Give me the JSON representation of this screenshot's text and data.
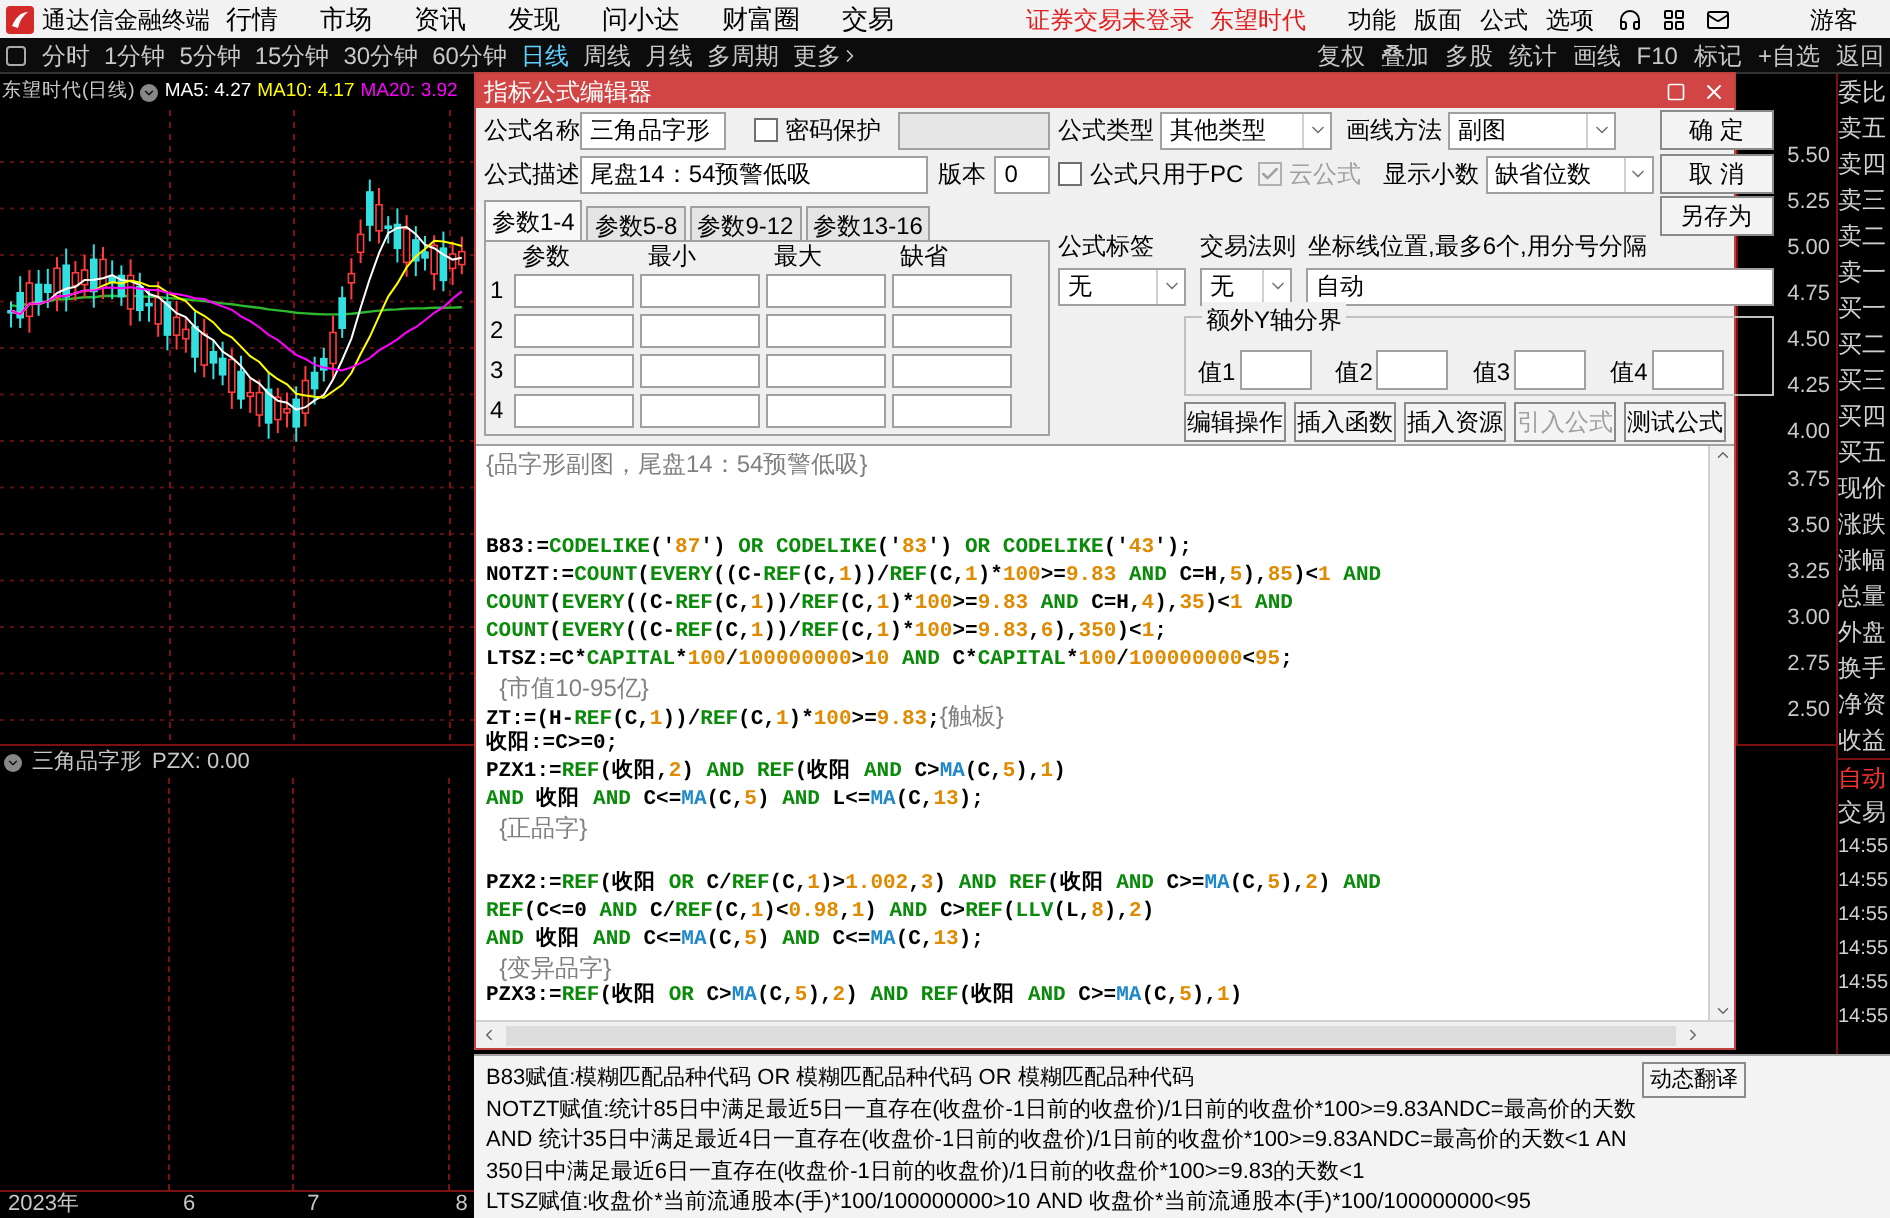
{
  "app_bar": {
    "title": "通达信金融终端",
    "menus": [
      "行情",
      "市场",
      "资讯",
      "发现",
      "问小达",
      "财富圈",
      "交易"
    ],
    "login_status": "证券交易未登录",
    "stock_name": "东望时代",
    "actions": [
      "功能",
      "版面",
      "公式",
      "选项"
    ],
    "user": "游客"
  },
  "toolbar": {
    "periods": [
      {
        "label": "分时",
        "selected": false
      },
      {
        "label": "1分钟",
        "selected": false
      },
      {
        "label": "5分钟",
        "selected": false
      },
      {
        "label": "15分钟",
        "selected": false
      },
      {
        "label": "30分钟",
        "selected": false
      },
      {
        "label": "60分钟",
        "selected": false
      },
      {
        "label": "日线",
        "selected": true
      },
      {
        "label": "周线",
        "selected": false
      },
      {
        "label": "月线",
        "selected": false
      },
      {
        "label": "多周期",
        "selected": false
      }
    ],
    "more": "更多",
    "tools": [
      "复权",
      "叠加",
      "多股",
      "统计",
      "画线",
      "F10",
      "标记",
      "+自选",
      "返回"
    ]
  },
  "chart": {
    "title": "东望时代(日线)",
    "averages": [
      {
        "label": "MA5: 4.27",
        "color": "#ffffff"
      },
      {
        "label": "MA10: 4.17",
        "color": "#ffff00"
      },
      {
        "label": "MA20: 3.92",
        "color": "#ff00ff"
      }
    ],
    "price_labels": [
      "5.50",
      "5.25",
      "5.00",
      "4.75",
      "4.50",
      "4.25",
      "4.00",
      "3.75",
      "3.50",
      "3.25",
      "3.00",
      "2.75",
      "2.50"
    ]
  },
  "indicator": {
    "title": "三角品字形",
    "reading": "PZX: 0.00"
  },
  "time_axis": [
    "2023年",
    "6",
    "7",
    "8"
  ],
  "quote_panel": {
    "labels": [
      "委比",
      "卖五",
      "卖四",
      "卖三",
      "卖二",
      "卖一",
      "买一",
      "买二",
      "买三",
      "买四",
      "买五",
      "现价",
      "涨跌",
      "涨幅",
      "总量",
      "外盘",
      "换手",
      "净资",
      "收益"
    ],
    "mode": "自动",
    "trade": "交易",
    "times": [
      "14:55",
      "14:55",
      "14:55",
      "14:55",
      "14:55",
      "14:55"
    ]
  },
  "dialog": {
    "title": "指标公式编辑器",
    "name": {
      "label": "公式名称",
      "value": "三角品字形"
    },
    "password": {
      "label": "密码保护",
      "checked": false
    },
    "description": {
      "label": "公式描述",
      "value": "尾盘14：54预警低吸"
    },
    "version": {
      "label": "版本",
      "value": "0"
    },
    "formula_type": {
      "label": "公式类型",
      "value": "其他类型"
    },
    "draw_method": {
      "label": "画线方法",
      "value": "副图"
    },
    "pc_only": {
      "label": "公式只用于PC",
      "checked": false,
      "disabled": false
    },
    "cloud": {
      "label": "云公式",
      "checked": true,
      "disabled": true
    },
    "decimals": {
      "label": "显示小数",
      "value": "缺省位数"
    },
    "buttons": [
      "确 定",
      "取 消",
      "另存为"
    ],
    "param_tabs": [
      {
        "label": "参数1-4",
        "selected": true
      },
      {
        "label": "参数5-8",
        "selected": false
      },
      {
        "label": "参数9-12",
        "selected": false
      },
      {
        "label": "参数13-16",
        "selected": false
      }
    ],
    "param_columns": [
      "参数",
      "最小",
      "最大",
      "缺省"
    ],
    "param_rows": [
      "1",
      "2",
      "3",
      "4"
    ],
    "tag": {
      "label": "公式标签",
      "value": "无"
    },
    "trade_rule": {
      "label": "交易法则",
      "value": "无"
    },
    "axis_lines": {
      "label": "坐标线位置,最多6个,用分号分隔",
      "value": "自动"
    },
    "y_bounds": {
      "title": "额外Y轴分界",
      "fields": [
        "值1",
        "值2",
        "值3",
        "值4"
      ]
    },
    "actions": [
      {
        "label": "编辑操作",
        "disabled": false
      },
      {
        "label": "插入函数",
        "disabled": false
      },
      {
        "label": "插入资源",
        "disabled": false
      },
      {
        "label": "引入公式",
        "disabled": true
      },
      {
        "label": "测试公式",
        "disabled": false
      }
    ],
    "code_lines": [
      {
        "kind": "code",
        "segments": [
          {
            "kind": "cmt",
            "text": "{品字形副图，尾盘14：54预警低吸}"
          }
        ]
      },
      {
        "kind": "blank"
      },
      {
        "kind": "blank"
      },
      {
        "kind": "code",
        "segments": [
          {
            "kind": "id",
            "text": "B83:="
          },
          {
            "kind": "fn",
            "text": "CODELIKE"
          },
          {
            "kind": "id",
            "text": "('"
          },
          {
            "kind": "num",
            "text": "87"
          },
          {
            "kind": "id",
            "text": "') "
          },
          {
            "kind": "fn",
            "text": "OR CODELIKE"
          },
          {
            "kind": "id",
            "text": "('"
          },
          {
            "kind": "num",
            "text": "83"
          },
          {
            "kind": "id",
            "text": "') "
          },
          {
            "kind": "fn",
            "text": "OR CODELIKE"
          },
          {
            "kind": "id",
            "text": "('"
          },
          {
            "kind": "num",
            "text": "43"
          },
          {
            "kind": "id",
            "text": "');"
          }
        ]
      },
      {
        "kind": "code",
        "segments": [
          {
            "kind": "id",
            "text": "NOTZT:="
          },
          {
            "kind": "fn",
            "text": "COUNT"
          },
          {
            "kind": "id",
            "text": "("
          },
          {
            "kind": "fn",
            "text": "EVERY"
          },
          {
            "kind": "id",
            "text": "((C-"
          },
          {
            "kind": "fn",
            "text": "REF"
          },
          {
            "kind": "id",
            "text": "(C,"
          },
          {
            "kind": "num",
            "text": "1"
          },
          {
            "kind": "id",
            "text": "))/"
          },
          {
            "kind": "fn",
            "text": "REF"
          },
          {
            "kind": "id",
            "text": "(C,"
          },
          {
            "kind": "num",
            "text": "1"
          },
          {
            "kind": "id",
            "text": ")*"
          },
          {
            "kind": "num",
            "text": "100"
          },
          {
            "kind": "id",
            "text": ">="
          },
          {
            "kind": "num",
            "text": "9.83"
          },
          {
            "kind": "fn",
            "text": " AND "
          },
          {
            "kind": "id",
            "text": "C=H,"
          },
          {
            "kind": "num",
            "text": "5"
          },
          {
            "kind": "id",
            "text": "),"
          },
          {
            "kind": "num",
            "text": "85"
          },
          {
            "kind": "id",
            "text": ")<"
          },
          {
            "kind": "num",
            "text": "1"
          },
          {
            "kind": "fn",
            "text": " AND"
          }
        ]
      },
      {
        "kind": "code",
        "segments": [
          {
            "kind": "fn",
            "text": "COUNT"
          },
          {
            "kind": "id",
            "text": "("
          },
          {
            "kind": "fn",
            "text": "EVERY"
          },
          {
            "kind": "id",
            "text": "((C-"
          },
          {
            "kind": "fn",
            "text": "REF"
          },
          {
            "kind": "id",
            "text": "(C,"
          },
          {
            "kind": "num",
            "text": "1"
          },
          {
            "kind": "id",
            "text": "))/"
          },
          {
            "kind": "fn",
            "text": "REF"
          },
          {
            "kind": "id",
            "text": "(C,"
          },
          {
            "kind": "num",
            "text": "1"
          },
          {
            "kind": "id",
            "text": ")*"
          },
          {
            "kind": "num",
            "text": "100"
          },
          {
            "kind": "id",
            "text": ">="
          },
          {
            "kind": "num",
            "text": "9.83"
          },
          {
            "kind": "fn",
            "text": " AND "
          },
          {
            "kind": "id",
            "text": "C=H,"
          },
          {
            "kind": "num",
            "text": "4"
          },
          {
            "kind": "id",
            "text": "),"
          },
          {
            "kind": "num",
            "text": "35"
          },
          {
            "kind": "id",
            "text": ")<"
          },
          {
            "kind": "num",
            "text": "1"
          },
          {
            "kind": "fn",
            "text": " AND"
          }
        ]
      },
      {
        "kind": "code",
        "segments": [
          {
            "kind": "fn",
            "text": "COUNT"
          },
          {
            "kind": "id",
            "text": "("
          },
          {
            "kind": "fn",
            "text": "EVERY"
          },
          {
            "kind": "id",
            "text": "((C-"
          },
          {
            "kind": "fn",
            "text": "REF"
          },
          {
            "kind": "id",
            "text": "(C,"
          },
          {
            "kind": "num",
            "text": "1"
          },
          {
            "kind": "id",
            "text": "))/"
          },
          {
            "kind": "fn",
            "text": "REF"
          },
          {
            "kind": "id",
            "text": "(C,"
          },
          {
            "kind": "num",
            "text": "1"
          },
          {
            "kind": "id",
            "text": ")*"
          },
          {
            "kind": "num",
            "text": "100"
          },
          {
            "kind": "id",
            "text": ">="
          },
          {
            "kind": "num",
            "text": "9.83"
          },
          {
            "kind": "id",
            "text": ","
          },
          {
            "kind": "num",
            "text": "6"
          },
          {
            "kind": "id",
            "text": "),"
          },
          {
            "kind": "num",
            "text": "350"
          },
          {
            "kind": "id",
            "text": ")<"
          },
          {
            "kind": "num",
            "text": "1"
          },
          {
            "kind": "id",
            "text": ";"
          }
        ]
      },
      {
        "kind": "code",
        "segments": [
          {
            "kind": "id",
            "text": "LTSZ:=C*"
          },
          {
            "kind": "fn",
            "text": "CAPITAL"
          },
          {
            "kind": "id",
            "text": "*"
          },
          {
            "kind": "num",
            "text": "100"
          },
          {
            "kind": "id",
            "text": "/"
          },
          {
            "kind": "num",
            "text": "100000000"
          },
          {
            "kind": "id",
            "text": ">"
          },
          {
            "kind": "num",
            "text": "10"
          },
          {
            "kind": "fn",
            "text": " AND "
          },
          {
            "kind": "id",
            "text": "C*"
          },
          {
            "kind": "fn",
            "text": "CAPITAL"
          },
          {
            "kind": "id",
            "text": "*"
          },
          {
            "kind": "num",
            "text": "100"
          },
          {
            "kind": "id",
            "text": "/"
          },
          {
            "kind": "num",
            "text": "100000000"
          },
          {
            "kind": "id",
            "text": "<"
          },
          {
            "kind": "num",
            "text": "95"
          },
          {
            "kind": "id",
            "text": ";"
          }
        ]
      },
      {
        "kind": "code",
        "segments": [
          {
            "kind": "cmt",
            "text": "  {市值10-95亿}"
          }
        ]
      },
      {
        "kind": "code",
        "segments": [
          {
            "kind": "id",
            "text": "ZT:=(H-"
          },
          {
            "kind": "fn",
            "text": "REF"
          },
          {
            "kind": "id",
            "text": "(C,"
          },
          {
            "kind": "num",
            "text": "1"
          },
          {
            "kind": "id",
            "text": "))/"
          },
          {
            "kind": "fn",
            "text": "REF"
          },
          {
            "kind": "id",
            "text": "(C,"
          },
          {
            "kind": "num",
            "text": "1"
          },
          {
            "kind": "id",
            "text": ")*"
          },
          {
            "kind": "num",
            "text": "100"
          },
          {
            "kind": "id",
            "text": ">="
          },
          {
            "kind": "num",
            "text": "9.83"
          },
          {
            "kind": "id",
            "text": ";"
          },
          {
            "kind": "cmt",
            "text": "{触板}"
          }
        ]
      },
      {
        "kind": "code",
        "segments": [
          {
            "kind": "id",
            "text": "收阳:=C>=0;"
          }
        ]
      },
      {
        "kind": "code",
        "segments": [
          {
            "kind": "id",
            "text": "PZX1:="
          },
          {
            "kind": "fn",
            "text": "REF"
          },
          {
            "kind": "id",
            "text": "(收阳,"
          },
          {
            "kind": "num",
            "text": "2"
          },
          {
            "kind": "id",
            "text": ")"
          },
          {
            "kind": "fn",
            "text": " AND REF"
          },
          {
            "kind": "id",
            "text": "(收阳"
          },
          {
            "kind": "fn",
            "text": " AND "
          },
          {
            "kind": "id",
            "text": "C>"
          },
          {
            "kind": "ma",
            "text": "MA"
          },
          {
            "kind": "id",
            "text": "(C,"
          },
          {
            "kind": "num",
            "text": "5"
          },
          {
            "kind": "id",
            "text": "),"
          },
          {
            "kind": "num",
            "text": "1"
          },
          {
            "kind": "id",
            "text": ")"
          }
        ]
      },
      {
        "kind": "code",
        "segments": [
          {
            "kind": "fn",
            "text": "AND "
          },
          {
            "kind": "id",
            "text": "收阳"
          },
          {
            "kind": "fn",
            "text": " AND "
          },
          {
            "kind": "id",
            "text": "C<="
          },
          {
            "kind": "ma",
            "text": "MA"
          },
          {
            "kind": "id",
            "text": "(C,"
          },
          {
            "kind": "num",
            "text": "5"
          },
          {
            "kind": "id",
            "text": ")"
          },
          {
            "kind": "fn",
            "text": " AND "
          },
          {
            "kind": "id",
            "text": "L<="
          },
          {
            "kind": "ma",
            "text": "MA"
          },
          {
            "kind": "id",
            "text": "(C,"
          },
          {
            "kind": "num",
            "text": "13"
          },
          {
            "kind": "id",
            "text": ");"
          }
        ]
      },
      {
        "kind": "code",
        "segments": [
          {
            "kind": "cmt",
            "text": "  {正品字}"
          }
        ]
      },
      {
        "kind": "blank"
      },
      {
        "kind": "code",
        "segments": [
          {
            "kind": "id",
            "text": "PZX2:="
          },
          {
            "kind": "fn",
            "text": "REF"
          },
          {
            "kind": "id",
            "text": "(收阳"
          },
          {
            "kind": "fn",
            "text": " OR "
          },
          {
            "kind": "id",
            "text": "C/"
          },
          {
            "kind": "fn",
            "text": "REF"
          },
          {
            "kind": "id",
            "text": "(C,"
          },
          {
            "kind": "num",
            "text": "1"
          },
          {
            "kind": "id",
            "text": ")>"
          },
          {
            "kind": "num",
            "text": "1.002"
          },
          {
            "kind": "id",
            "text": ","
          },
          {
            "kind": "num",
            "text": "3"
          },
          {
            "kind": "id",
            "text": ")"
          },
          {
            "kind": "fn",
            "text": " AND REF"
          },
          {
            "kind": "id",
            "text": "(收阳"
          },
          {
            "kind": "fn",
            "text": " AND "
          },
          {
            "kind": "id",
            "text": "C>="
          },
          {
            "kind": "ma",
            "text": "MA"
          },
          {
            "kind": "id",
            "text": "(C,"
          },
          {
            "kind": "num",
            "text": "5"
          },
          {
            "kind": "id",
            "text": "),"
          },
          {
            "kind": "num",
            "text": "2"
          },
          {
            "kind": "id",
            "text": ")"
          },
          {
            "kind": "fn",
            "text": " AND"
          }
        ]
      },
      {
        "kind": "code",
        "segments": [
          {
            "kind": "fn",
            "text": "REF"
          },
          {
            "kind": "id",
            "text": "(C<=0"
          },
          {
            "kind": "fn",
            "text": " AND "
          },
          {
            "kind": "id",
            "text": "C/"
          },
          {
            "kind": "fn",
            "text": "REF"
          },
          {
            "kind": "id",
            "text": "(C,"
          },
          {
            "kind": "num",
            "text": "1"
          },
          {
            "kind": "id",
            "text": ")<"
          },
          {
            "kind": "num",
            "text": "0.98"
          },
          {
            "kind": "id",
            "text": ","
          },
          {
            "kind": "num",
            "text": "1"
          },
          {
            "kind": "id",
            "text": ")"
          },
          {
            "kind": "fn",
            "text": " AND "
          },
          {
            "kind": "id",
            "text": "C>"
          },
          {
            "kind": "fn",
            "text": "REF"
          },
          {
            "kind": "id",
            "text": "("
          },
          {
            "kind": "fn",
            "text": "LLV"
          },
          {
            "kind": "id",
            "text": "(L,"
          },
          {
            "kind": "num",
            "text": "8"
          },
          {
            "kind": "id",
            "text": "),"
          },
          {
            "kind": "num",
            "text": "2"
          },
          {
            "kind": "id",
            "text": ")"
          }
        ]
      },
      {
        "kind": "code",
        "segments": [
          {
            "kind": "fn",
            "text": "AND "
          },
          {
            "kind": "id",
            "text": "收阳"
          },
          {
            "kind": "fn",
            "text": " AND "
          },
          {
            "kind": "id",
            "text": "C<="
          },
          {
            "kind": "ma",
            "text": "MA"
          },
          {
            "kind": "id",
            "text": "(C,"
          },
          {
            "kind": "num",
            "text": "5"
          },
          {
            "kind": "id",
            "text": ")"
          },
          {
            "kind": "fn",
            "text": " AND "
          },
          {
            "kind": "id",
            "text": "C<="
          },
          {
            "kind": "ma",
            "text": "MA"
          },
          {
            "kind": "id",
            "text": "(C,"
          },
          {
            "kind": "num",
            "text": "13"
          },
          {
            "kind": "id",
            "text": ");"
          }
        ]
      },
      {
        "kind": "code",
        "segments": [
          {
            "kind": "cmt",
            "text": "  {变异品字}"
          }
        ]
      },
      {
        "kind": "code",
        "segments": [
          {
            "kind": "id",
            "text": "PZX3:="
          },
          {
            "kind": "fn",
            "text": "REF"
          },
          {
            "kind": "id",
            "text": "(收阳"
          },
          {
            "kind": "fn",
            "text": " OR "
          },
          {
            "kind": "id",
            "text": "C>"
          },
          {
            "kind": "ma",
            "text": "MA"
          },
          {
            "kind": "id",
            "text": "(C,"
          },
          {
            "kind": "num",
            "text": "5"
          },
          {
            "kind": "id",
            "text": "),"
          },
          {
            "kind": "num",
            "text": "2"
          },
          {
            "kind": "id",
            "text": ")"
          },
          {
            "kind": "fn",
            "text": " AND REF"
          },
          {
            "kind": "id",
            "text": "(收阳"
          },
          {
            "kind": "fn",
            "text": " AND "
          },
          {
            "kind": "id",
            "text": "C>="
          },
          {
            "kind": "ma",
            "text": "MA"
          },
          {
            "kind": "id",
            "text": "(C,"
          },
          {
            "kind": "num",
            "text": "5"
          },
          {
            "kind": "id",
            "text": "),"
          },
          {
            "kind": "num",
            "text": "1"
          },
          {
            "kind": "id",
            "text": ")"
          }
        ]
      }
    ]
  },
  "translation": {
    "lines": [
      "B83赋值:模糊匹配品种代码 OR 模糊匹配品种代码 OR 模糊匹配品种代码",
      "NOTZT赋值:统计85日中满足最近5日一直存在(收盘价-1日前的收盘价)/1日前的收盘价*100>=9.83ANDC=最高价的天数",
      "AND 统计35日中满足最近4日一直存在(收盘价-1日前的收盘价)/1日前的收盘价*100>=9.83ANDC=最高价的天数<1 AN",
      "350日中满足最近6日一直存在(收盘价-1日前的收盘价)/1日前的收盘价*100>=9.83的天数<1",
      "LTSZ赋值:收盘价*当前流通股本(手)*100/100000000>10 AND 收盘价*当前流通股本(手)*100/100000000<95"
    ],
    "button": "动态翻译"
  }
}
